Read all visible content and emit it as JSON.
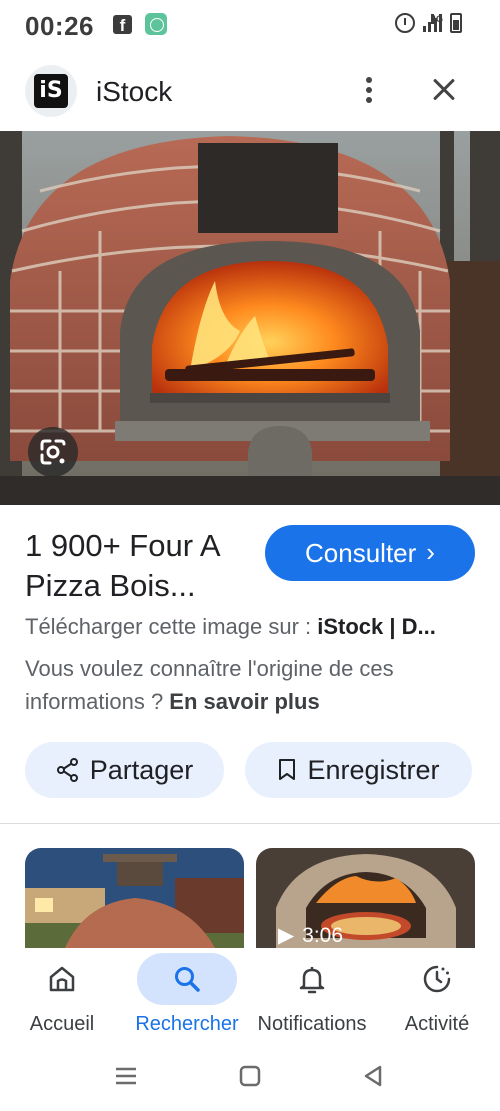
{
  "status_bar": {
    "time": "00:26",
    "network": "4G",
    "icons": [
      "facebook-icon",
      "app-update-icon",
      "alarm-icon",
      "signal-icon",
      "battery-icon"
    ]
  },
  "header": {
    "logo_text": "iS",
    "title": "iStock",
    "more_icon": "more-vert-icon",
    "close_icon": "close-icon"
  },
  "hero": {
    "lens_icon": "google-lens-icon"
  },
  "result": {
    "title": "1 900+ Four A Pizza Bois...",
    "consult_label": "Consulter",
    "source_prefix": "Télécharger cette image sur : ",
    "source_name": "iStock | D...",
    "origin_text": "Vous voulez connaître l'origine de ces informations ? ",
    "origin_link": "En savoir plus",
    "share_label": "Partager",
    "save_label": "Enregistrer"
  },
  "related": {
    "video_duration": "3:06"
  },
  "bottom_nav": {
    "items": [
      {
        "label": "Accueil",
        "icon": "home-icon"
      },
      {
        "label": "Rechercher",
        "icon": "search-icon",
        "active": true
      },
      {
        "label": "Notifications",
        "icon": "bell-icon"
      },
      {
        "label": "Activité",
        "icon": "activity-icon"
      }
    ]
  },
  "colors": {
    "accent": "#1a73e8",
    "pill_bg": "#e8f0fe",
    "active_nav_bg": "#d3e3fd"
  }
}
